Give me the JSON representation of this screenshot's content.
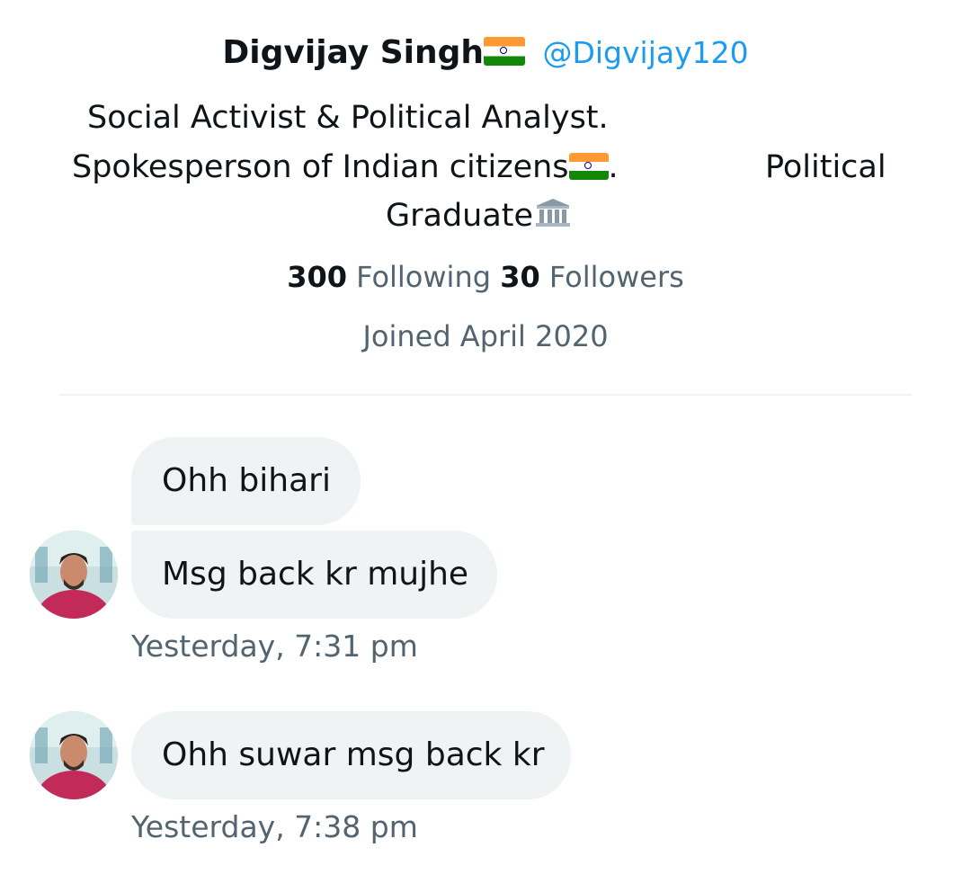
{
  "profile": {
    "display_name": "Digvijay Singh",
    "handle": "@Digvijay120",
    "bio_line1": "Social Activist & Political Analyst.",
    "bio_line2a": "Spokesperson of Indian citizens",
    "bio_line2b": ".",
    "bio_line2c": "Political",
    "bio_line3": "Graduate",
    "following_count": "300",
    "following_label": "Following",
    "followers_count": "30",
    "followers_label": "Followers",
    "joined": "Joined April 2020"
  },
  "messages": [
    {
      "text": "Ohh bihari"
    },
    {
      "text": "Msg back kr mujhe"
    },
    {
      "text": "Ohh suwar msg back kr"
    }
  ],
  "timestamps": [
    "Yesterday, 7:31 pm",
    "Yesterday, 7:38 pm"
  ],
  "icons": {
    "flag": "india-flag-emoji",
    "classical_building": "classical-building-emoji"
  },
  "colors": {
    "handle": "#1d9bf0",
    "secondary_text": "#536471",
    "bubble": "#eff3f4",
    "primary_text": "#0f1419"
  }
}
